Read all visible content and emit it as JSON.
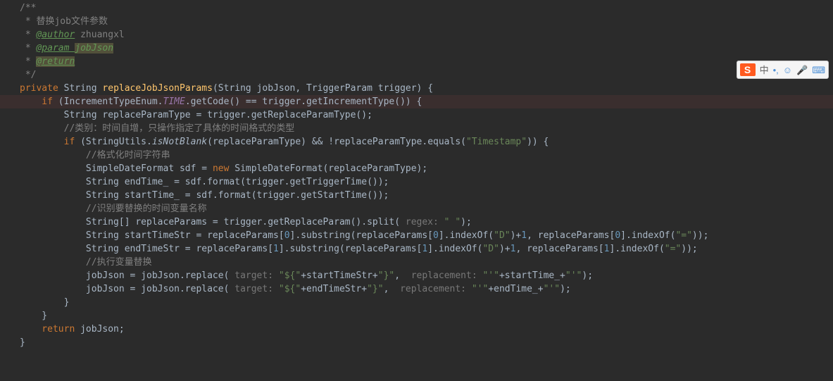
{
  "code": {
    "c1": "/**",
    "c2": " * 替换job文件参数",
    "c3_a": " * ",
    "c3_b": "@author",
    "c3_c": " zhuangxl",
    "c4_a": " * ",
    "c4_b": "@param ",
    "c4_c": "jobJson",
    "c5_a": " * ",
    "c5_b": "@return",
    "c6": " */",
    "l7_a": "private ",
    "l7_b": "String ",
    "l7_c": "replaceJobJsonParams",
    "l7_d": "(String jobJson, TriggerParam trigger) {",
    "l8_a": "    if ",
    "l8_b": "(IncrementTypeEnum.",
    "l8_c": "TIME",
    "l8_d": ".getCode() == trigger.getIncrementType()) {",
    "l9": "        String replaceParamType = trigger.getReplaceParamType();",
    "l10": "        //类别：时间自增，只操作指定了具体的时间格式的类型",
    "l11_a": "        if ",
    "l11_b": "(StringUtils.",
    "l11_c": "isNotBlank",
    "l11_d": "(replaceParamType) && !replaceParamType.equals(",
    "l11_e": "\"Timestamp\"",
    "l11_f": ")) {",
    "l12": "",
    "l13": "            //格式化时间字符串",
    "l14_a": "            SimpleDateFormat sdf = ",
    "l14_b": "new ",
    "l14_c": "SimpleDateFormat(replaceParamType);",
    "l15": "            String endTime_ = sdf.format(trigger.getTriggerTime());",
    "l16": "            String startTime_ = sdf.format(trigger.getStartTime());",
    "l17": "",
    "l18": "            //识别要替换的时间变量名称",
    "l19_a": "            String[] replaceParams = trigger.getReplaceParam().split(",
    "l19_h": " regex: ",
    "l19_b": "\" \"",
    "l19_c": ");",
    "l20_a": "            String startTimeStr = replaceParams[",
    "l20_b": "0",
    "l20_c": "].substring(replaceParams[",
    "l20_d": "0",
    "l20_e": "].indexOf(",
    "l20_f": "\"D\"",
    "l20_g": ")+",
    "l20_h": "1",
    "l20_i": ", replaceParams[",
    "l20_j": "0",
    "l20_k": "].indexOf(",
    "l20_l": "\"=\"",
    "l20_m": "));",
    "l21_a": "            String endTimeStr = replaceParams[",
    "l21_b": "1",
    "l21_c": "].substring(replaceParams[",
    "l21_d": "1",
    "l21_e": "].indexOf(",
    "l21_f": "\"D\"",
    "l21_g": ")+",
    "l21_h": "1",
    "l21_i": ", replaceParams[",
    "l21_j": "1",
    "l21_k": "].indexOf(",
    "l21_l": "\"=\"",
    "l21_m": "));",
    "l22": "            //执行变量替换",
    "l23_a": "            jobJson = jobJson.replace(",
    "l23_h1": " target: ",
    "l23_b": "\"${\"",
    "l23_c": "+startTimeStr+",
    "l23_d": "\"}\"",
    "l23_e": ", ",
    "l23_h2": " replacement: ",
    "l23_f": "\"'\"",
    "l23_g": "+startTime_+",
    "l23_i": "\"'\"",
    "l23_j": ");",
    "l24_a": "            jobJson = jobJson.replace(",
    "l24_h1": " target: ",
    "l24_b": "\"${\"",
    "l24_c": "+endTimeStr+",
    "l24_d": "\"}\"",
    "l24_e": ", ",
    "l24_h2": " replacement: ",
    "l24_f": "\"'\"",
    "l24_g": "+endTime_+",
    "l24_i": "\"'\"",
    "l24_j": ");",
    "l25": "        }",
    "l26": "    }",
    "l27_a": "    return ",
    "l27_b": "jobJson;",
    "l28": "}"
  },
  "ime": {
    "logo": "S",
    "lang": "中",
    "punct": "•,",
    "face": "☺",
    "mic": "🎤",
    "kbd": "⌨"
  }
}
